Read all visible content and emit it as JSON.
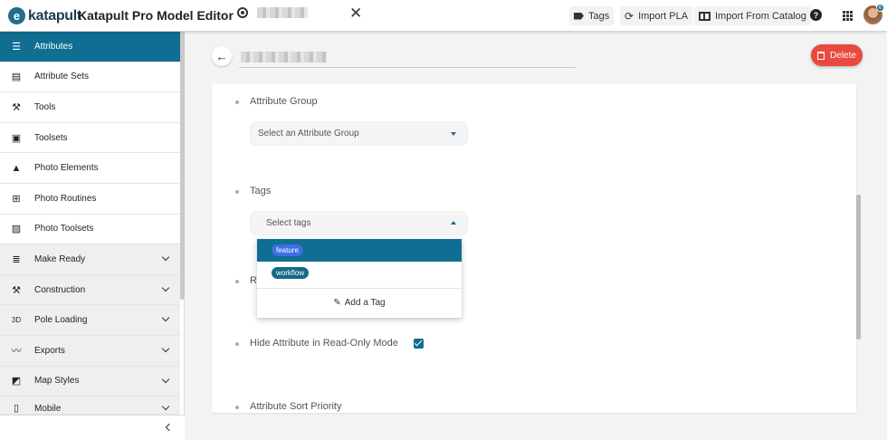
{
  "header": {
    "logo_text": "katapult",
    "app_title": "Katapult Pro Model Editor",
    "buttons": {
      "tags": "Tags",
      "import_pla": "Import PLA",
      "import_catalog": "Import From Catalog"
    },
    "avatar_badge": "6"
  },
  "sidebar": {
    "items": [
      {
        "label": "Attributes",
        "icon": "list-icon"
      },
      {
        "label": "Attribute Sets",
        "icon": "table-icon"
      },
      {
        "label": "Tools",
        "icon": "tools-icon"
      },
      {
        "label": "Toolsets",
        "icon": "toolbox-icon"
      },
      {
        "label": "Photo Elements",
        "icon": "shapes-icon"
      },
      {
        "label": "Photo Routines",
        "icon": "add-box-icon"
      },
      {
        "label": "Photo Toolsets",
        "icon": "image-stack-icon"
      },
      {
        "label": "Make Ready",
        "icon": "sort-lines-icon"
      },
      {
        "label": "Construction",
        "icon": "tools-icon"
      },
      {
        "label": "Pole Loading",
        "icon": "3d-icon"
      },
      {
        "label": "Exports",
        "icon": "trend-icon"
      },
      {
        "label": "Map Styles",
        "icon": "map-style-icon"
      },
      {
        "label": "Mobile",
        "icon": "phone-icon"
      }
    ]
  },
  "main": {
    "delete_label": "Delete",
    "fields": {
      "attribute_group_label": "Attribute Group",
      "attribute_group_placeholder": "Select an Attribute Group",
      "tags_label": "Tags",
      "tags_placeholder": "Select tags",
      "hidden_label_partial": "R",
      "hide_readonly_label": "Hide Attribute in Read-Only Mode",
      "sort_priority_label": "Attribute Sort Priority"
    },
    "dropdown": {
      "options": [
        {
          "label": "feature",
          "color": "#3b6fe3"
        },
        {
          "label": "workflow",
          "color": "#136a8a"
        }
      ],
      "add_label": "Add a Tag"
    }
  },
  "colors": {
    "primary": "#0f6e92",
    "delete": "#e84a3f"
  }
}
